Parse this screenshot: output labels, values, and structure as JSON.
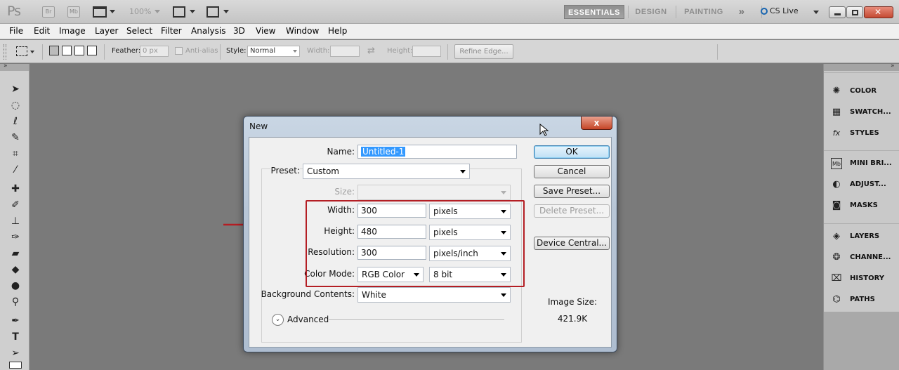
{
  "appbar": {
    "logo": "Ps",
    "bridge_label": "Br",
    "minibridge_label": "Mb",
    "zoom": "100%",
    "workspaces": [
      "ESSENTIALS",
      "DESIGN",
      "PAINTING"
    ],
    "more": "»",
    "cslive": "CS Live"
  },
  "menu": [
    "File",
    "Edit",
    "Image",
    "Layer",
    "Select",
    "Filter",
    "Analysis",
    "3D",
    "View",
    "Window",
    "Help"
  ],
  "options": {
    "feather_label": "Feather:",
    "feather_value": "0 px",
    "antialias_label": "Anti-alias",
    "style_label": "Style:",
    "style_value": "Normal",
    "width_label": "Width:",
    "height_label": "Height:",
    "refine_label": "Refine Edge..."
  },
  "dock": {
    "groups": [
      [
        {
          "label": "COLOR",
          "icon": "palette-icon"
        },
        {
          "label": "SWATCH...",
          "icon": "swatches-icon"
        },
        {
          "label": "STYLES",
          "icon": "fx-icon"
        }
      ],
      [
        {
          "label": "MINI BRI...",
          "icon": "mini-bridge-icon"
        },
        {
          "label": "ADJUST...",
          "icon": "adjustments-icon"
        },
        {
          "label": "MASKS",
          "icon": "masks-icon"
        }
      ],
      [
        {
          "label": "LAYERS",
          "icon": "layers-icon"
        },
        {
          "label": "CHANNE...",
          "icon": "channels-icon"
        },
        {
          "label": "HISTORY",
          "icon": "history-icon"
        },
        {
          "label": "PATHS",
          "icon": "paths-icon"
        }
      ]
    ]
  },
  "dialog": {
    "title": "New",
    "close": "x",
    "name_label": "Name:",
    "name_value": "Untitled-1",
    "preset_label": "Preset:",
    "preset_value": "Custom",
    "size_label": "Size:",
    "width_label": "Width:",
    "width_value": "300",
    "width_unit": "pixels",
    "height_label": "Height:",
    "height_value": "480",
    "height_unit": "pixels",
    "resolution_label": "Resolution:",
    "resolution_value": "300",
    "resolution_unit": "pixels/inch",
    "colormode_label": "Color Mode:",
    "colormode_value": "RGB Color",
    "bitdepth_value": "8 bit",
    "background_label": "Background Contents:",
    "background_value": "White",
    "advanced_label": "Advanced",
    "buttons": {
      "ok": "OK",
      "cancel": "Cancel",
      "save_preset": "Save Preset...",
      "delete_preset": "Delete Preset...",
      "device_central": "Device Central..."
    },
    "image_size_label": "Image Size:",
    "image_size_value": "421.9K"
  }
}
